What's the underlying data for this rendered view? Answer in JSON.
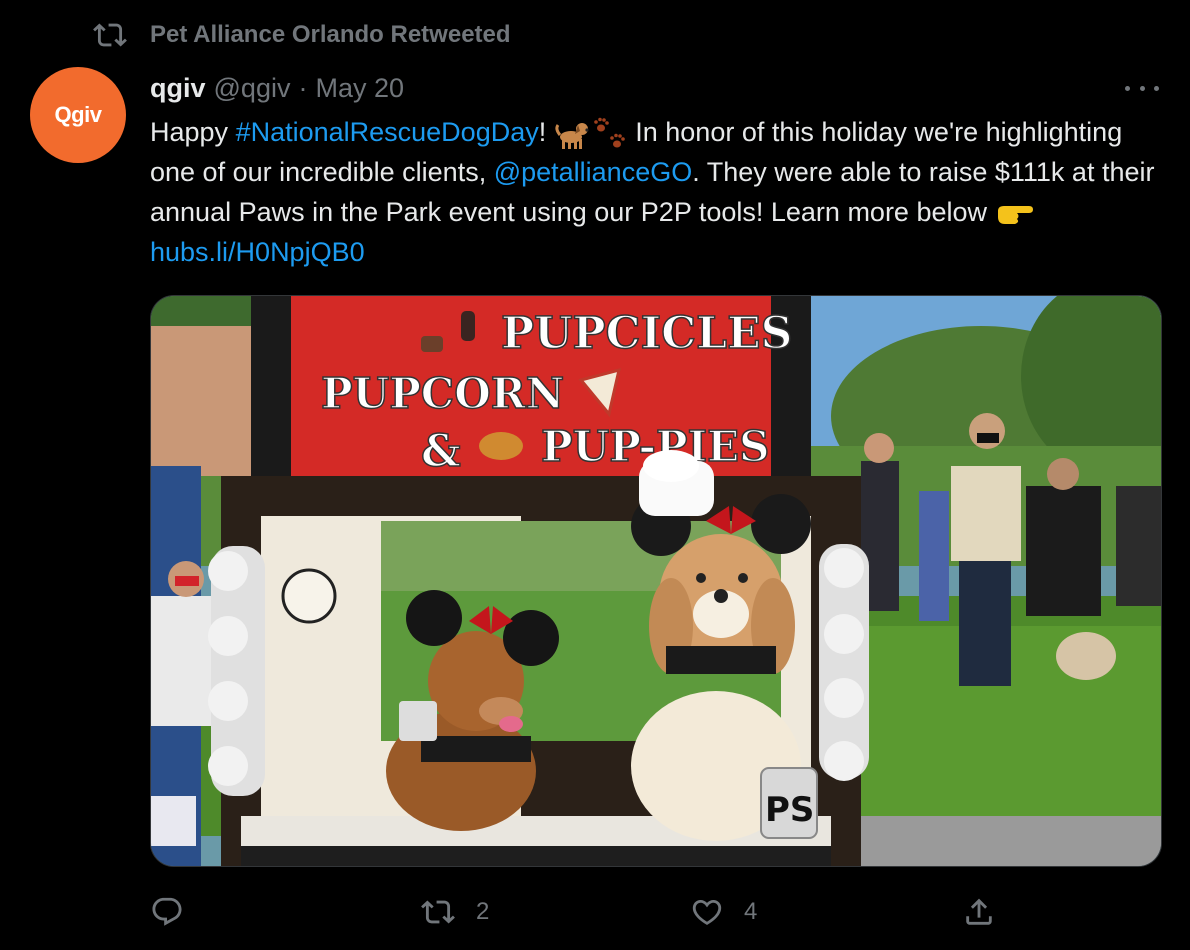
{
  "retweet_banner": {
    "text": "Pet Alliance Orlando Retweeted",
    "icon": "retweet-icon"
  },
  "author": {
    "avatar_text": "Qgiv",
    "display_name": "qgiv",
    "handle": "@qgiv",
    "separator": "·",
    "date": "May 20",
    "avatar_color": "#f26b2d"
  },
  "tweet": {
    "t1": "Happy ",
    "hashtag": "#NationalRescueDogDay",
    "t2": "! ",
    "t3": "  In honor of this holiday we're highlighting one of our incredible clients, ",
    "mention": "@petallianceGO",
    "t4": ". They were able to raise $111k at their annual Paws in the Park event using our P2P tools! Learn more below ",
    "link": "hubs.li/H0NpjQB0",
    "link_color": "#1d9bf0"
  },
  "media": {
    "sign_line1": "PUPCICLES",
    "sign_line2": "PUPCORN",
    "sign_amp": "&",
    "sign_line3": "PUP-PIES",
    "jar_text": "PS",
    "sign_color": "#d42a26"
  },
  "actions": {
    "reply_icon": "reply-icon",
    "retweet_count": "2",
    "like_count": "4",
    "share_icon": "share-icon"
  }
}
